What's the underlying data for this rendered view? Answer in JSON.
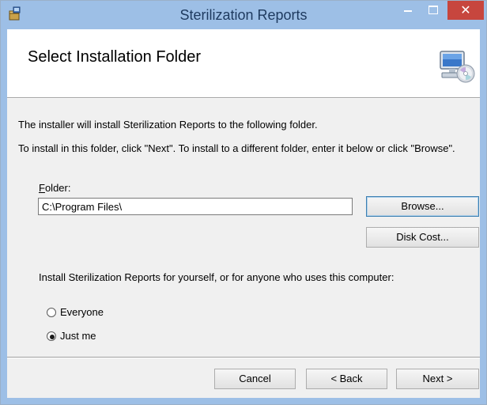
{
  "window": {
    "title": "Sterilization Reports",
    "close_glyph": "✕",
    "title_bar_color": "#9dbfe6",
    "close_button_color": "#c7463e"
  },
  "header": {
    "heading": "Select Installation Folder",
    "icon": "computer-cd-icon"
  },
  "body": {
    "description_line1": "The installer will install Sterilization Reports to the following folder.",
    "description_line2": "To install in this folder, click \"Next\". To install to a different folder, enter it below or click \"Browse\".",
    "folder_label_accel": "F",
    "folder_label_rest": "older:",
    "folder_value": "C:\\Program Files\\",
    "browse_label": "Browse...",
    "disk_cost_label": "Disk Cost...",
    "install_for_text": "Install Sterilization Reports for yourself, or for anyone who uses this computer:",
    "radio_options": [
      {
        "label": "Everyone",
        "selected": false
      },
      {
        "label": "Just me",
        "selected": true
      }
    ]
  },
  "footer": {
    "cancel_label": "Cancel",
    "back_label": "< Back",
    "next_label": "Next >"
  }
}
